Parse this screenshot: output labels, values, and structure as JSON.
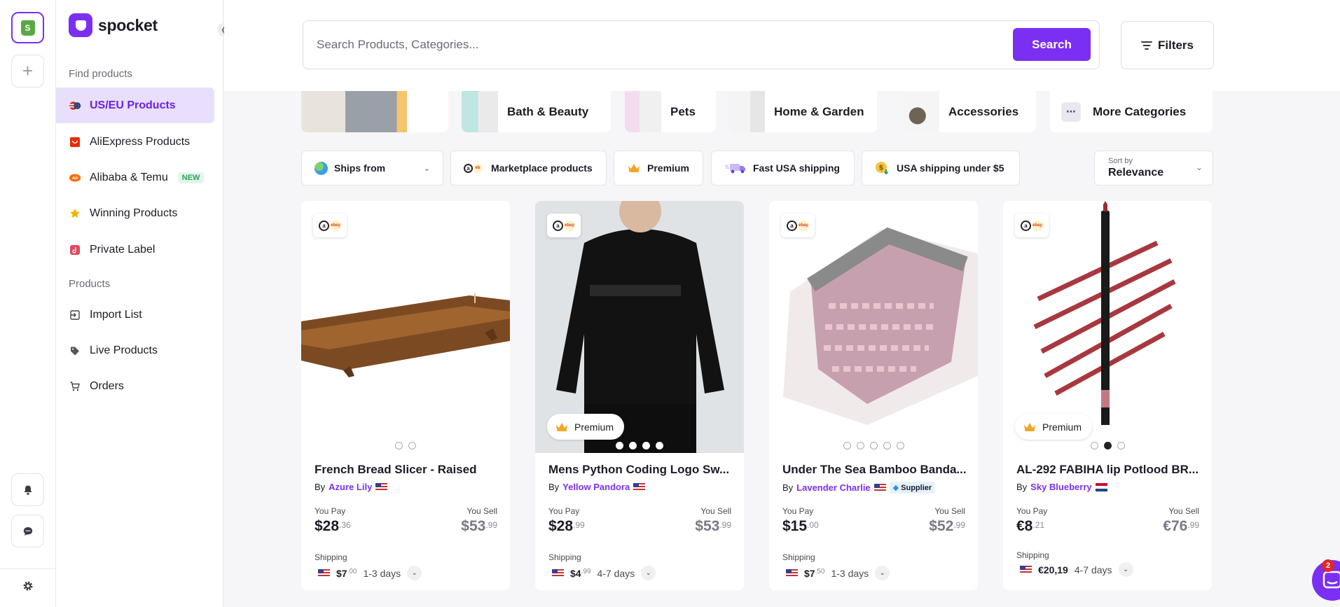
{
  "brand": {
    "name": "spocket",
    "accent": "#7b2ff2"
  },
  "sidebar": {
    "section_find": "Find products",
    "section_products": "Products",
    "find_items": [
      {
        "label": "US/EU Products",
        "icon": "flag-icon",
        "active": true
      },
      {
        "label": "AliExpress Products",
        "icon": "aliexpress-icon"
      },
      {
        "label": "Alibaba & Temu",
        "icon": "alibaba-icon",
        "badge": "NEW"
      },
      {
        "label": "Winning Products",
        "icon": "star-icon"
      },
      {
        "label": "Private Label",
        "icon": "private-label-icon"
      }
    ],
    "product_items": [
      {
        "label": "Import List",
        "icon": "import-icon"
      },
      {
        "label": "Live Products",
        "icon": "tag-icon"
      },
      {
        "label": "Orders",
        "icon": "cart-icon"
      }
    ]
  },
  "search": {
    "placeholder": "Search Products, Categories...",
    "button": "Search"
  },
  "filters_label": "Filters",
  "categories": [
    "Bath & Beauty",
    "Pets",
    "Home & Garden",
    "Accessories",
    "More Categories"
  ],
  "chips": [
    "Ships from",
    "Marketplace products",
    "Premium",
    "Fast USA shipping",
    "USA shipping under $5"
  ],
  "sort": {
    "label": "Sort by",
    "value": "Relevance"
  },
  "labels": {
    "by": "By",
    "you_pay": "You Pay",
    "you_sell": "You Sell",
    "shipping": "Shipping",
    "premium": "Premium",
    "supplier": "Supplier"
  },
  "products": [
    {
      "title": "French Bread Slicer - Raised",
      "seller": "Azure Lily",
      "pay_main": "$28",
      "pay_cents": ".36",
      "sell_main": "$53",
      "sell_cents": ".99",
      "ship_main": "$7",
      "ship_cents": ".00",
      "ship_time": "1-3 days"
    },
    {
      "title": "Mens Python Coding Logo Sw...",
      "seller": "Yellow Pandora",
      "pay_main": "$28",
      "pay_cents": ".99",
      "sell_main": "$53",
      "sell_cents": ".99",
      "ship_main": "$4",
      "ship_cents": ".99",
      "ship_time": "4-7 days"
    },
    {
      "title": "Under The Sea Bamboo Banda...",
      "seller": "Lavender Charlie",
      "pay_main": "$15",
      "pay_cents": ".00",
      "sell_main": "$52",
      "sell_cents": ".99",
      "ship_main": "$7",
      "ship_cents": ".50",
      "ship_time": "1-3 days"
    },
    {
      "title": "AL-292 FABIHA lip Potlood BR...",
      "seller": "Sky Blueberry",
      "pay_main": "€8",
      "pay_cents": ".21",
      "sell_main": "€76",
      "sell_cents": ".99",
      "ship_main": "€20,19",
      "ship_cents": "",
      "ship_time": "4-7 days"
    }
  ],
  "chat_badge": "2"
}
